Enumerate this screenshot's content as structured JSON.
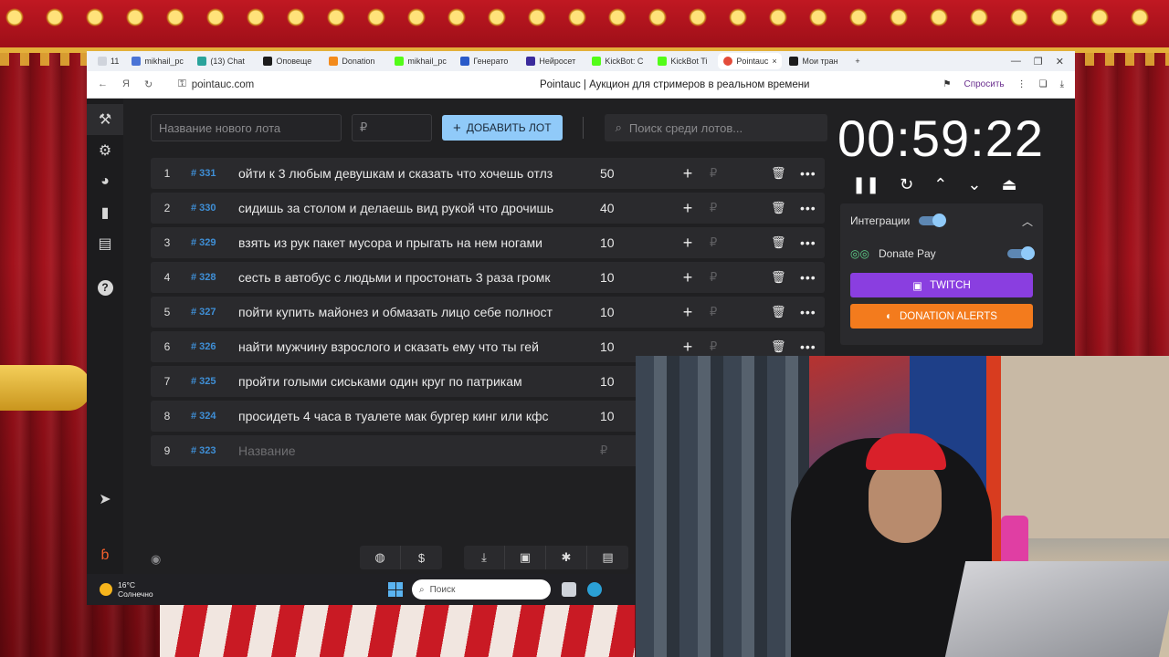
{
  "browser": {
    "tabs": [
      {
        "label": "11",
        "color": "#d0d4dc"
      },
      {
        "label": "mikhail_pc",
        "color": "#4b74d6"
      },
      {
        "label": "(13) Chat",
        "color": "#2ba39b"
      },
      {
        "label": "Оповеще",
        "color": "#1c1c1c"
      },
      {
        "label": "Donation",
        "color": "#f38b1c"
      },
      {
        "label": "mikhail_pc",
        "color": "#53fc18"
      },
      {
        "label": "Генерато",
        "color": "#2a5ac9"
      },
      {
        "label": "Нейросет",
        "color": "#3b2b9c"
      },
      {
        "label": "KickBot: C",
        "color": "#53fc18"
      },
      {
        "label": "KickBot Ti",
        "color": "#53fc18"
      },
      {
        "label": "Pointauc",
        "color": "#e34b3a",
        "active": true
      },
      {
        "label": "Мои тран",
        "color": "#1c1c1c"
      }
    ],
    "url": "pointauc.com",
    "page_title": "Pointauc | Аукцион для стримеров в реальном времени",
    "ask_label": "Спросить"
  },
  "toolbar": {
    "name_placeholder": "Название нового лота",
    "amount_placeholder": "₽",
    "add_button": "ДОБАВИТЬ ЛОТ",
    "search_placeholder": "Поиск среди лотов..."
  },
  "lots": [
    {
      "num": "1",
      "id": "# 331",
      "name": "ойти к 3 любым девушкам и сказать что хочешь отлз",
      "amount": "50"
    },
    {
      "num": "2",
      "id": "# 330",
      "name": "сидишь за столом и делаешь вид рукой что дрочишь",
      "amount": "40"
    },
    {
      "num": "3",
      "id": "# 329",
      "name": "взять из рук пакет мусора и  прыгать на нем ногами",
      "amount": "10"
    },
    {
      "num": "4",
      "id": "# 328",
      "name": "сесть в автобус с людьми и простонать 3 раза громк",
      "amount": "10"
    },
    {
      "num": "5",
      "id": "# 327",
      "name": "пойти купить майонез и обмазать лицо себе полност",
      "amount": "10"
    },
    {
      "num": "6",
      "id": "# 326",
      "name": "найти мужчину взрослого и сказать ему что ты гей",
      "amount": "10"
    },
    {
      "num": "7",
      "id": "# 325",
      "name": "пройти голыми сиськами один круг по патрикам",
      "amount": "10"
    },
    {
      "num": "8",
      "id": "# 324",
      "name": "просидеть 4 часа в туалете мак бургер кинг или кфс",
      "amount": "10"
    }
  ],
  "new_lot": {
    "num": "9",
    "id": "# 323",
    "placeholder": "Название",
    "currency": "₽"
  },
  "rub_symbol": "₽",
  "timer": {
    "value": "00:59:22"
  },
  "integrations": {
    "title": "Интеграции",
    "enabled": true,
    "donate_pay": {
      "label": "Donate Pay",
      "enabled": true
    },
    "twitch_label": "TWITCH",
    "da_label": "DONATION ALERTS"
  },
  "taskbar": {
    "temperature": "16°C",
    "weather": "Солнечно",
    "search_label": "Поиск"
  },
  "colors": {
    "accent_blue": "#90caf9",
    "twitch": "#8a3ee0",
    "donation_alerts": "#f37b1d",
    "lot_id": "#3f8fd6"
  }
}
